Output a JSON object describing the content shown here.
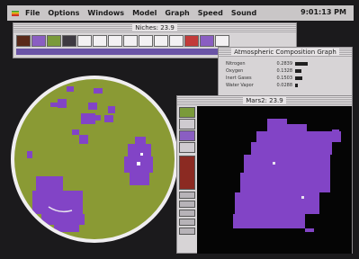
{
  "menubar": {
    "items": [
      "File",
      "Options",
      "Windows",
      "Model",
      "Graph",
      "Speed",
      "Sound"
    ],
    "clock": "9:01:13 PM"
  },
  "niches_window": {
    "title": "Niches: 23.9"
  },
  "atmosphere_window": {
    "title": "Atmospheric Composition Graph",
    "rows": [
      {
        "name": "Nitrogen",
        "value": "0.2839"
      },
      {
        "name": "Oxygen",
        "value": "0.1328"
      },
      {
        "name": "Inert Gases",
        "value": "0.1503"
      },
      {
        "name": "Water Vapor",
        "value": "0.0288"
      }
    ]
  },
  "mars_window": {
    "title": "Mars2: 23.9"
  },
  "colors": {
    "land": "#8a9a34",
    "life": "#8244c6",
    "background": "#1b1a1c"
  }
}
